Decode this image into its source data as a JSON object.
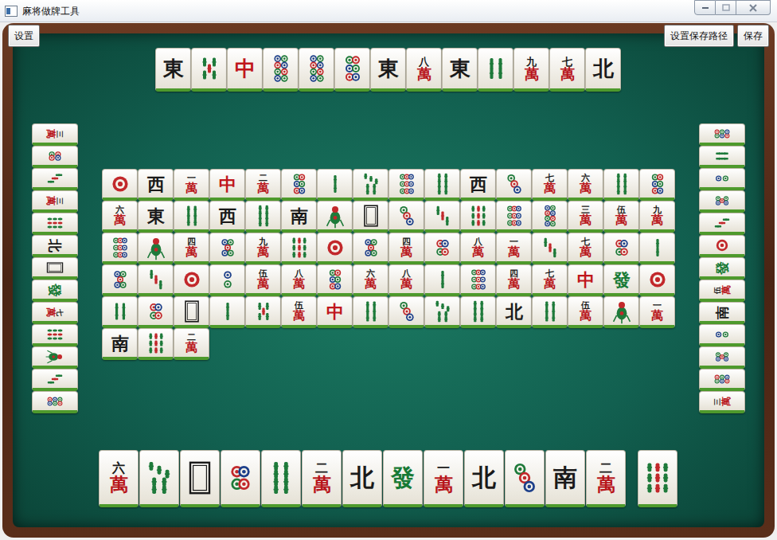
{
  "window": {
    "title": "麻将做牌工具"
  },
  "toolbar": {
    "left_button": "设置",
    "right_buttons": [
      "设置保存路径",
      "保存"
    ]
  },
  "top_row": [
    {
      "kind": "honor",
      "text": "東",
      "color": "#1a1a1a"
    },
    {
      "kind": "bamboo",
      "count": 5
    },
    {
      "kind": "honor",
      "text": "中",
      "color": "#c0161c"
    },
    {
      "kind": "dots",
      "count": 8
    },
    {
      "kind": "dots",
      "count": 8
    },
    {
      "kind": "dots",
      "count": 6
    },
    {
      "kind": "honor",
      "text": "東",
      "color": "#1a1a1a"
    },
    {
      "kind": "wan",
      "rank": "八",
      "suit": "萬"
    },
    {
      "kind": "honor",
      "text": "東",
      "color": "#1a1a1a"
    },
    {
      "kind": "bamboo",
      "count": 4
    },
    {
      "kind": "wan",
      "rank": "九",
      "suit": "萬"
    },
    {
      "kind": "wan",
      "rank": "七",
      "suit": "萬"
    },
    {
      "kind": "honor",
      "text": "北",
      "color": "#1a1a1a"
    }
  ],
  "left_column": [
    {
      "kind": "wan",
      "rank": "三",
      "suit": "萬"
    },
    {
      "kind": "dots",
      "count": 4
    },
    {
      "kind": "bamboo",
      "count": 3
    },
    {
      "kind": "wan",
      "rank": "三",
      "suit": "萬"
    },
    {
      "kind": "bamboo",
      "count": 9
    },
    {
      "kind": "honor",
      "text": "北",
      "color": "#1a1a1a"
    },
    {
      "kind": "white"
    },
    {
      "kind": "honor",
      "text": "發",
      "color": "#177a35"
    },
    {
      "kind": "wan",
      "rank": "七",
      "suit": "萬"
    },
    {
      "kind": "bamboo",
      "count": 9
    },
    {
      "kind": "bamboo",
      "count": 1
    },
    {
      "kind": "bamboo",
      "count": 3
    },
    {
      "kind": "dots",
      "count": 6
    }
  ],
  "right_column": [
    {
      "kind": "dots",
      "count": 6
    },
    {
      "kind": "bamboo",
      "count": 4
    },
    {
      "kind": "dots",
      "count": 2
    },
    {
      "kind": "dots",
      "count": 5
    },
    {
      "kind": "bamboo",
      "count": 3
    },
    {
      "kind": "dots",
      "count": 1
    },
    {
      "kind": "honor",
      "text": "發",
      "color": "#177a35"
    },
    {
      "kind": "wan",
      "rank": "伍",
      "suit": "萬"
    },
    {
      "kind": "honor",
      "text": "南",
      "color": "#1a1a1a"
    },
    {
      "kind": "dots",
      "count": 2
    },
    {
      "kind": "dots",
      "count": 5
    },
    {
      "kind": "dots",
      "count": 6
    },
    {
      "kind": "wan",
      "rank": "三",
      "suit": "萬"
    }
  ],
  "wall_rows": [
    [
      {
        "kind": "dots",
        "count": 1
      },
      {
        "kind": "honor",
        "text": "西",
        "color": "#1a1a1a"
      },
      {
        "kind": "wan",
        "rank": "一",
        "suit": "萬"
      },
      {
        "kind": "honor",
        "text": "中",
        "color": "#c0161c"
      },
      {
        "kind": "wan",
        "rank": "二",
        "suit": "萬"
      },
      {
        "kind": "dots",
        "count": 6
      },
      {
        "kind": "bamboo",
        "count": 2
      },
      {
        "kind": "bamboo",
        "count": 7
      },
      {
        "kind": "dots",
        "count": 9
      },
      {
        "kind": "bamboo",
        "count": 8
      },
      {
        "kind": "honor",
        "text": "西",
        "color": "#1a1a1a"
      },
      {
        "kind": "dots",
        "count": 3
      },
      {
        "kind": "wan",
        "rank": "七",
        "suit": "萬"
      },
      {
        "kind": "wan",
        "rank": "六",
        "suit": "萬"
      },
      {
        "kind": "bamboo",
        "count": 8
      },
      {
        "kind": "dots",
        "count": 6
      }
    ],
    [
      {
        "kind": "wan",
        "rank": "六",
        "suit": "萬"
      },
      {
        "kind": "honor",
        "text": "東",
        "color": "#1a1a1a"
      },
      {
        "kind": "bamboo",
        "count": 6
      },
      {
        "kind": "honor",
        "text": "西",
        "color": "#1a1a1a"
      },
      {
        "kind": "bamboo",
        "count": 8
      },
      {
        "kind": "honor",
        "text": "南",
        "color": "#1a1a1a"
      },
      {
        "kind": "bamboo",
        "count": 1
      },
      {
        "kind": "white"
      },
      {
        "kind": "dots",
        "count": 3
      },
      {
        "kind": "bamboo",
        "count": 3
      },
      {
        "kind": "bamboo",
        "count": 9
      },
      {
        "kind": "dots",
        "count": 9
      },
      {
        "kind": "dots",
        "count": 8
      },
      {
        "kind": "wan",
        "rank": "三",
        "suit": "萬"
      },
      {
        "kind": "wan",
        "rank": "伍",
        "suit": "萬"
      },
      {
        "kind": "wan",
        "rank": "九",
        "suit": "萬"
      }
    ],
    [
      {
        "kind": "dots",
        "count": 9
      },
      {
        "kind": "bamboo",
        "count": 1
      },
      {
        "kind": "wan",
        "rank": "四",
        "suit": "萬"
      },
      {
        "kind": "dots",
        "count": 5
      },
      {
        "kind": "wan",
        "rank": "九",
        "suit": "萬"
      },
      {
        "kind": "bamboo",
        "count": 9
      },
      {
        "kind": "dots",
        "count": 1
      },
      {
        "kind": "dots",
        "count": 5
      },
      {
        "kind": "wan",
        "rank": "四",
        "suit": "萬"
      },
      {
        "kind": "dots",
        "count": 4
      },
      {
        "kind": "wan",
        "rank": "八",
        "suit": "萬"
      },
      {
        "kind": "wan",
        "rank": "一",
        "suit": "萬"
      },
      {
        "kind": "bamboo",
        "count": 3
      },
      {
        "kind": "wan",
        "rank": "七",
        "suit": "萬"
      },
      {
        "kind": "dots",
        "count": 4
      },
      {
        "kind": "bamboo",
        "count": 2
      }
    ],
    [
      {
        "kind": "dots",
        "count": 5
      },
      {
        "kind": "bamboo",
        "count": 3
      },
      {
        "kind": "dots",
        "count": 1
      },
      {
        "kind": "dots",
        "count": 2
      },
      {
        "kind": "wan",
        "rank": "伍",
        "suit": "萬"
      },
      {
        "kind": "wan",
        "rank": "八",
        "suit": "萬"
      },
      {
        "kind": "dots",
        "count": 6
      },
      {
        "kind": "wan",
        "rank": "六",
        "suit": "萬"
      },
      {
        "kind": "wan",
        "rank": "八",
        "suit": "萬"
      },
      {
        "kind": "bamboo",
        "count": 2
      },
      {
        "kind": "dots",
        "count": 9
      },
      {
        "kind": "wan",
        "rank": "四",
        "suit": "萬"
      },
      {
        "kind": "wan",
        "rank": "七",
        "suit": "萬"
      },
      {
        "kind": "honor",
        "text": "中",
        "color": "#c0161c"
      },
      {
        "kind": "honor",
        "text": "發",
        "color": "#177a35"
      },
      {
        "kind": "dots",
        "count": 1
      }
    ],
    [
      {
        "kind": "bamboo",
        "count": 4
      },
      {
        "kind": "dots",
        "count": 4
      },
      {
        "kind": "white"
      },
      {
        "kind": "bamboo",
        "count": 2
      },
      {
        "kind": "bamboo",
        "count": 5
      },
      {
        "kind": "wan",
        "rank": "伍",
        "suit": "萬"
      },
      {
        "kind": "honor",
        "text": "中",
        "color": "#c0161c"
      },
      {
        "kind": "bamboo",
        "count": 6
      },
      {
        "kind": "dots",
        "count": 3
      },
      {
        "kind": "bamboo",
        "count": 7
      },
      {
        "kind": "bamboo",
        "count": 8
      },
      {
        "kind": "honor",
        "text": "北",
        "color": "#1a1a1a"
      },
      {
        "kind": "bamboo",
        "count": 6
      },
      {
        "kind": "wan",
        "rank": "伍",
        "suit": "萬"
      },
      {
        "kind": "bamboo",
        "count": 1
      },
      {
        "kind": "wan",
        "rank": "一",
        "suit": "萬"
      }
    ],
    [
      {
        "kind": "honor",
        "text": "南",
        "color": "#1a1a1a"
      },
      {
        "kind": "bamboo",
        "count": 9
      },
      {
        "kind": "wan",
        "rank": "二",
        "suit": "萬"
      }
    ]
  ],
  "hand": [
    {
      "kind": "wan",
      "rank": "六",
      "suit": "萬"
    },
    {
      "kind": "bamboo",
      "count": 7
    },
    {
      "kind": "white"
    },
    {
      "kind": "dots",
      "count": 4
    },
    {
      "kind": "bamboo",
      "count": 8
    },
    {
      "kind": "wan",
      "rank": "二",
      "suit": "萬"
    },
    {
      "kind": "honor",
      "text": "北",
      "color": "#1a1a1a"
    },
    {
      "kind": "honor",
      "text": "發",
      "color": "#177a35"
    },
    {
      "kind": "wan",
      "rank": "一",
      "suit": "萬"
    },
    {
      "kind": "honor",
      "text": "北",
      "color": "#1a1a1a"
    },
    {
      "kind": "dots",
      "count": 3
    },
    {
      "kind": "honor",
      "text": "南",
      "color": "#1a1a1a"
    },
    {
      "kind": "wan",
      "rank": "二",
      "suit": "萬"
    }
  ],
  "drawn_tile": {
    "kind": "bamboo",
    "count": 9
  }
}
